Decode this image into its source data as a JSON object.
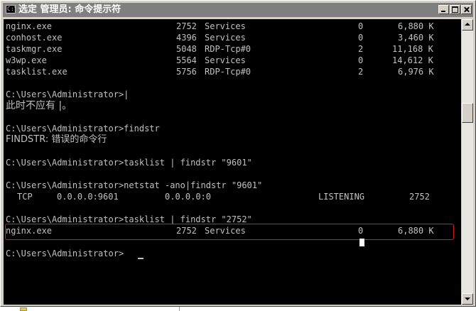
{
  "window": {
    "title": "选定 管理员: 命令提示符",
    "icon": "cmd-icon",
    "icon_label": "C:\\"
  },
  "colors": {
    "console_bg": "#000000",
    "console_text": "#c0c0c0",
    "highlight_border": "#d02020",
    "titlebar_inactive": "#7f7f7f"
  },
  "console": {
    "process_rows": [
      {
        "image": "nginx.exe",
        "pid": "2752",
        "session": "Services",
        "num": "0",
        "mem": "6,880 K"
      },
      {
        "image": "conhost.exe",
        "pid": "4396",
        "session": "Services",
        "num": "0",
        "mem": "3,460 K"
      },
      {
        "image": "taskmgr.exe",
        "pid": "5048",
        "session": "RDP-Tcp#0",
        "num": "2",
        "mem": "11,168 K"
      },
      {
        "image": "w3wp.exe",
        "pid": "5564",
        "session": "Services",
        "num": "0",
        "mem": "14,612 K"
      },
      {
        "image": "tasklist.exe",
        "pid": "5756",
        "session": "RDP-Tcp#0",
        "num": "2",
        "mem": "6,976 K"
      }
    ],
    "cmd1": "C:\\Users\\Administrator>|",
    "err1": "此时不应有 |。",
    "cmd2": "C:\\Users\\Administrator>findstr",
    "err2": "FINDSTR: 错误的命令行",
    "cmd3": "C:\\Users\\Administrator>tasklist | findstr \"9601\"",
    "cmd4": "C:\\Users\\Administrator>netstat -ano|findstr \"9601\"",
    "netstat_row": {
      "proto": "TCP",
      "local": "0.0.0.0:9601",
      "foreign": "0.0.0.0:0",
      "state": "LISTENING",
      "pid": "2752"
    },
    "cmd5": "C:\\Users\\Administrator>tasklist | findstr \"2752\"",
    "result_row": {
      "image": "nginx.exe",
      "pid": "2752",
      "session": "Services",
      "num": "0",
      "mem": "6,880 K"
    },
    "prompt": "C:\\Users\\Administrator>"
  }
}
